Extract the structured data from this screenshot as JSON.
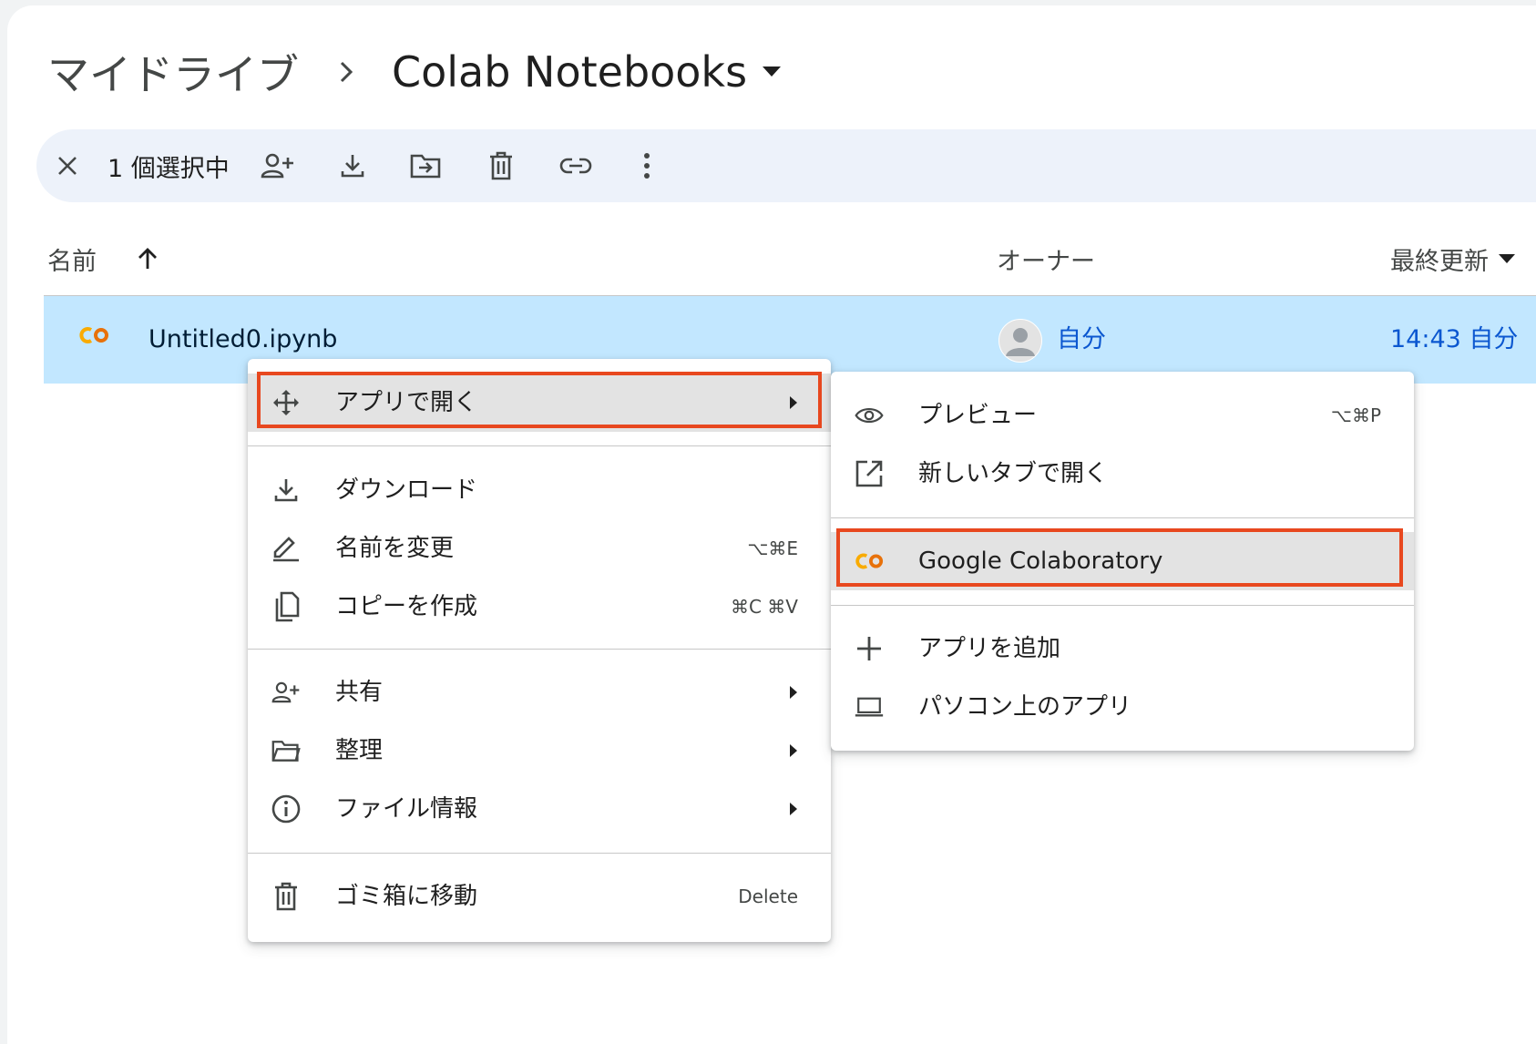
{
  "breadcrumb": {
    "root": "マイドライブ",
    "current": "Colab Notebooks"
  },
  "toolbar": {
    "selected_count": "1 個選択中",
    "icons": [
      "close-icon",
      "add-person-icon",
      "download-icon",
      "move-to-folder-icon",
      "trash-icon",
      "link-icon",
      "more-vert-icon"
    ]
  },
  "columns": {
    "name": "名前",
    "owner": "オーナー",
    "modified": "最終更新"
  },
  "file_row": {
    "name": "Untitled0.ipynb",
    "owner": "自分",
    "modified": "14:43 自分",
    "icon": "colab-icon"
  },
  "context_menu": {
    "open_with": "アプリで開く",
    "download": "ダウンロード",
    "rename": "名前を変更",
    "rename_shortcut": "⌥⌘E",
    "copy": "コピーを作成",
    "copy_shortcut": "⌘C ⌘V",
    "share": "共有",
    "organize": "整理",
    "file_info": "ファイル情報",
    "trash": "ゴミ箱に移動",
    "trash_shortcut": "Delete"
  },
  "submenu": {
    "preview": "プレビュー",
    "preview_shortcut": "⌥⌘P",
    "new_tab": "新しいタブで開く",
    "colab": "Google Colaboratory",
    "add_app": "アプリを追加",
    "desktop_apps": "パソコン上のアプリ"
  },
  "colors": {
    "selection_bg": "#c2e7ff",
    "toolbar_bg": "#edf2fa",
    "highlight_border": "#e8481f",
    "link_blue": "#0b57d0",
    "colab_orange": "#f9ab00"
  }
}
